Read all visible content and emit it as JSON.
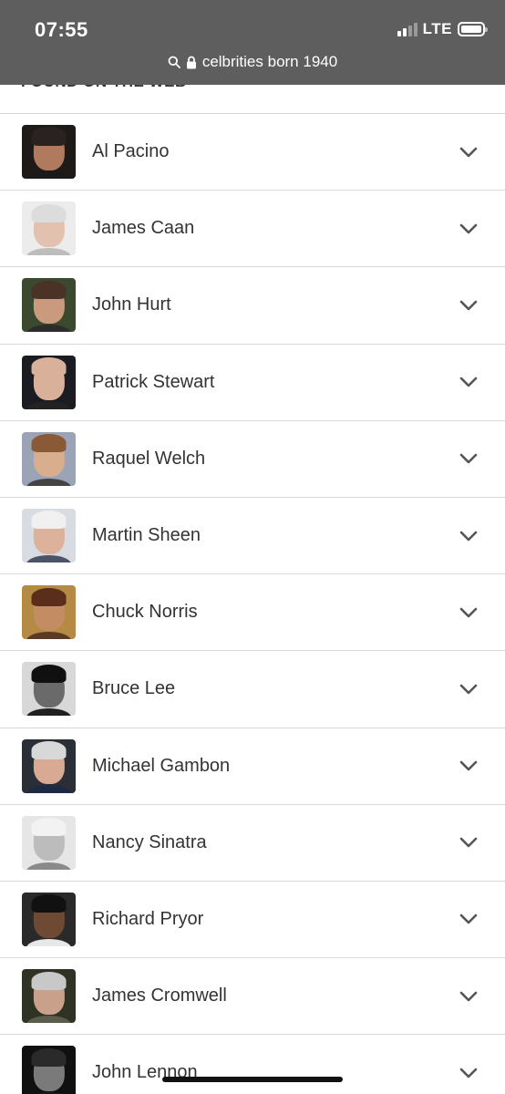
{
  "status_bar": {
    "time": "07:55",
    "network": "LTE",
    "battery_level": 1.0
  },
  "url_bar": {
    "text": "celbrities born 1940",
    "search_icon": "search-icon",
    "lock_icon": "lock-icon"
  },
  "section_peek": "FOUND ON THE WEB",
  "results": [
    {
      "name": "Al Pacino",
      "photo": {
        "bg": "#1e1a18",
        "skin": "#b07a5e",
        "hair": "#2a2220",
        "shirt": "#1a1a1a"
      }
    },
    {
      "name": "James Caan",
      "photo": {
        "bg": "#ececec",
        "skin": "#e2c2ae",
        "hair": "#dcdcdc",
        "shirt": "#bdbdbd"
      }
    },
    {
      "name": "John Hurt",
      "photo": {
        "bg": "#3b4a2e",
        "skin": "#c99a7e",
        "hair": "#4a3226",
        "shirt": "#2c2c2c"
      }
    },
    {
      "name": "Patrick Stewart",
      "photo": {
        "bg": "#1b1c22",
        "skin": "#d9b09a",
        "hair": "#d9b09a",
        "shirt": "#222"
      }
    },
    {
      "name": "Raquel Welch",
      "photo": {
        "bg": "#9aa4b6",
        "skin": "#d9ae8e",
        "hair": "#8a5a36",
        "shirt": "#444"
      }
    },
    {
      "name": "Martin Sheen",
      "photo": {
        "bg": "#d8dbe2",
        "skin": "#dcb29a",
        "hair": "#f0f0f0",
        "shirt": "#4a5368"
      }
    },
    {
      "name": "Chuck Norris",
      "photo": {
        "bg": "#b58a44",
        "skin": "#c48c62",
        "hair": "#5a2e1a",
        "shirt": "#5a3a22"
      }
    },
    {
      "name": "Bruce Lee",
      "photo": {
        "bg": "#d8d8d8",
        "skin": "#6a6a6a",
        "hair": "#101010",
        "shirt": "#202020"
      }
    },
    {
      "name": "Michael Gambon",
      "photo": {
        "bg": "#2a2e36",
        "skin": "#d8aa94",
        "hair": "#d8d8d8",
        "shirt": "#1e2a44"
      }
    },
    {
      "name": "Nancy Sinatra",
      "photo": {
        "bg": "#e6e6e6",
        "skin": "#bcbcbc",
        "hair": "#f2f2f2",
        "shirt": "#8a8a8a"
      }
    },
    {
      "name": "Richard Pryor",
      "photo": {
        "bg": "#2a2a2a",
        "skin": "#6e4a34",
        "hair": "#111111",
        "shirt": "#e8e8e8"
      }
    },
    {
      "name": "James Cromwell",
      "photo": {
        "bg": "#2e3324",
        "skin": "#c9a08a",
        "hair": "#c8c8c8",
        "shirt": "#5c5c4c"
      }
    },
    {
      "name": "John Lennon",
      "photo": {
        "bg": "#101010",
        "skin": "#7a7a7a",
        "hair": "#2a2a2a",
        "shirt": "#1a1a1a"
      }
    }
  ],
  "row_action_icon": "chevron-down-icon"
}
